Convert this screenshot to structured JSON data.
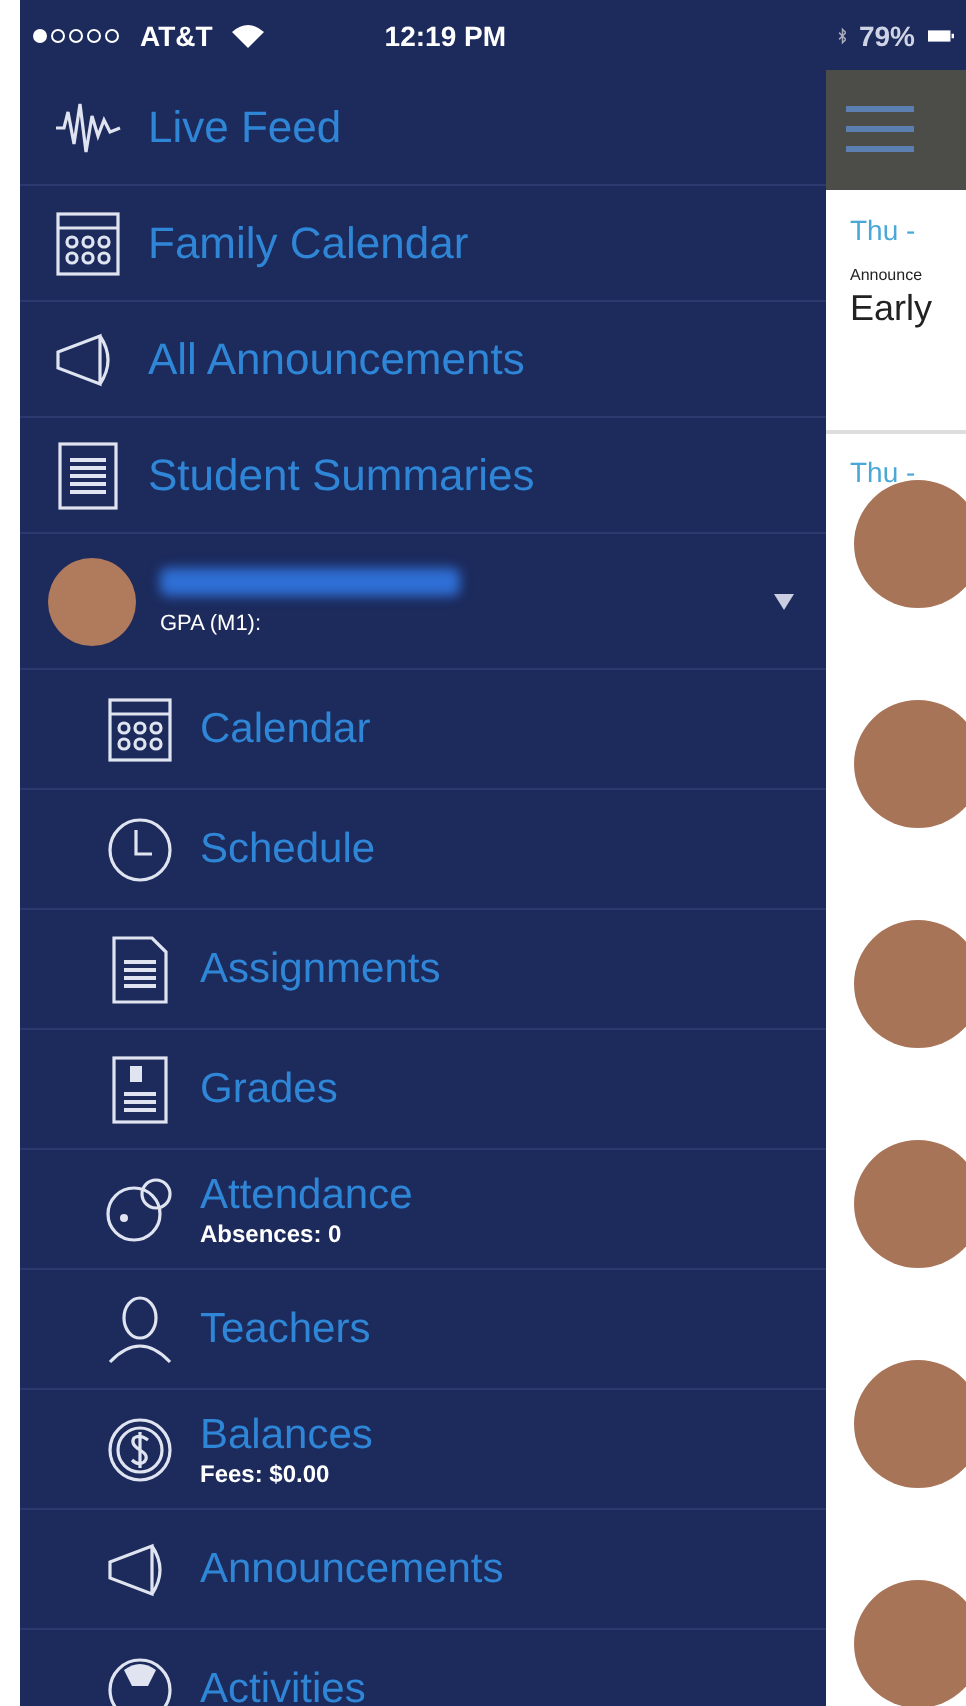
{
  "status_bar": {
    "carrier": "AT&T",
    "time": "12:19 PM",
    "battery": "79%"
  },
  "menu": {
    "items": [
      {
        "kind": "wave",
        "label": "Live Feed"
      },
      {
        "kind": "calendar",
        "label": "Family Calendar"
      },
      {
        "kind": "megaphone",
        "label": "All Announcements"
      },
      {
        "kind": "list",
        "label": "Student Summaries"
      }
    ],
    "student": {
      "gpa": "GPA (M1):",
      "expanded": true
    },
    "sub_items": [
      {
        "kind": "calendar",
        "label": "Calendar"
      },
      {
        "kind": "clock",
        "label": "Schedule"
      },
      {
        "kind": "document",
        "label": "Assignments"
      },
      {
        "kind": "grades",
        "label": "Grades"
      },
      {
        "kind": "attendance",
        "label": "Attendance",
        "subtitle": "Absences: 0"
      },
      {
        "kind": "person",
        "label": "Teachers"
      },
      {
        "kind": "dollar",
        "label": "Balances",
        "subtitle": "Fees: $0.00"
      },
      {
        "kind": "megaphone",
        "label": "Announcements"
      },
      {
        "kind": "ball",
        "label": "Activities"
      }
    ]
  },
  "feed": {
    "sections": [
      {
        "date": "Thu -",
        "category": "Announce",
        "title": "Early"
      },
      {
        "date": "Thu -"
      }
    ]
  }
}
